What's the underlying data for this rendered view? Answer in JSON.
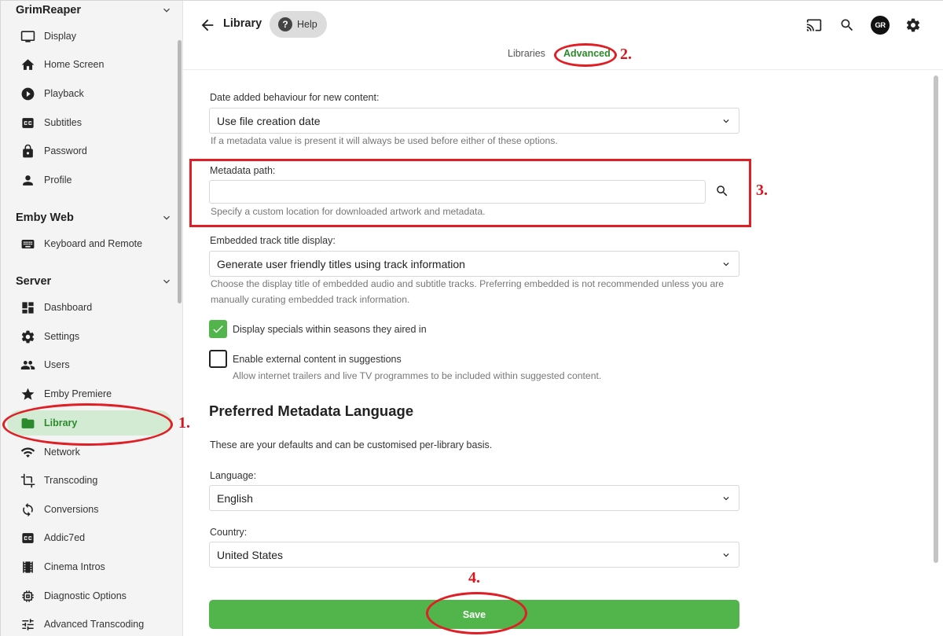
{
  "sidebar": {
    "sections": [
      {
        "title": "GrimReaper",
        "items": [
          {
            "label": "Display",
            "icon": "monitor-icon"
          },
          {
            "label": "Home Screen",
            "icon": "home-icon"
          },
          {
            "label": "Playback",
            "icon": "play-circle-icon"
          },
          {
            "label": "Subtitles",
            "icon": "cc-icon"
          },
          {
            "label": "Password",
            "icon": "lock-icon"
          },
          {
            "label": "Profile",
            "icon": "person-icon"
          }
        ]
      },
      {
        "title": "Emby Web",
        "items": [
          {
            "label": "Keyboard and Remote",
            "icon": "keyboard-icon"
          }
        ]
      },
      {
        "title": "Server",
        "items": [
          {
            "label": "Dashboard",
            "icon": "dashboard-icon"
          },
          {
            "label": "Settings",
            "icon": "gear-icon"
          },
          {
            "label": "Users",
            "icon": "users-icon"
          },
          {
            "label": "Emby Premiere",
            "icon": "star-icon"
          },
          {
            "label": "Library",
            "icon": "folder-icon",
            "active": true
          },
          {
            "label": "Network",
            "icon": "wifi-icon"
          },
          {
            "label": "Transcoding",
            "icon": "crop-icon"
          },
          {
            "label": "Conversions",
            "icon": "sync-icon"
          },
          {
            "label": "Addic7ed",
            "icon": "cc-icon"
          },
          {
            "label": "Cinema Intros",
            "icon": "film-icon"
          },
          {
            "label": "Diagnostic Options",
            "icon": "chip-icon"
          },
          {
            "label": "Advanced Transcoding",
            "icon": "tune-icon"
          }
        ]
      }
    ]
  },
  "header": {
    "title": "Library",
    "help_label": "Help",
    "tabs": [
      {
        "label": "Libraries",
        "active": false
      },
      {
        "label": "Advanced",
        "active": true
      }
    ],
    "avatar_initials": "GR",
    "icons": [
      "cast-icon",
      "search-icon",
      "settings-icon"
    ]
  },
  "form": {
    "date_added": {
      "label": "Date added behaviour for new content:",
      "value": "Use file creation date",
      "help": "If a metadata value is present it will always be used before either of these options."
    },
    "metadata_path": {
      "label": "Metadata path:",
      "value": "",
      "help": "Specify a custom location for downloaded artwork and metadata."
    },
    "track_title": {
      "label": "Embedded track title display:",
      "value": "Generate user friendly titles using track information",
      "help_line1": "Choose the display title of embedded audio and subtitle tracks. Preferring embedded is not recommended unless you are",
      "help_line2": "manually curating embedded track information."
    },
    "specials": {
      "label": "Display specials within seasons they aired in",
      "checked": true
    },
    "external": {
      "label": "Enable external content in suggestions",
      "checked": false,
      "help": "Allow internet trailers and live TV programmes to be included within suggested content."
    },
    "metadata_language": {
      "heading": "Preferred Metadata Language",
      "intro": "These are your defaults and can be customised per-library basis.",
      "language_label": "Language:",
      "language_value": "English",
      "country_label": "Country:",
      "country_value": "United States"
    },
    "save_label": "Save"
  },
  "annotations": {
    "step1": "1.",
    "step2": "2.",
    "step3": "3.",
    "step4": "4."
  },
  "colors": {
    "accent": "#52b54b",
    "accent_text": "#2b8a2b",
    "annotation": "#e01e26"
  }
}
